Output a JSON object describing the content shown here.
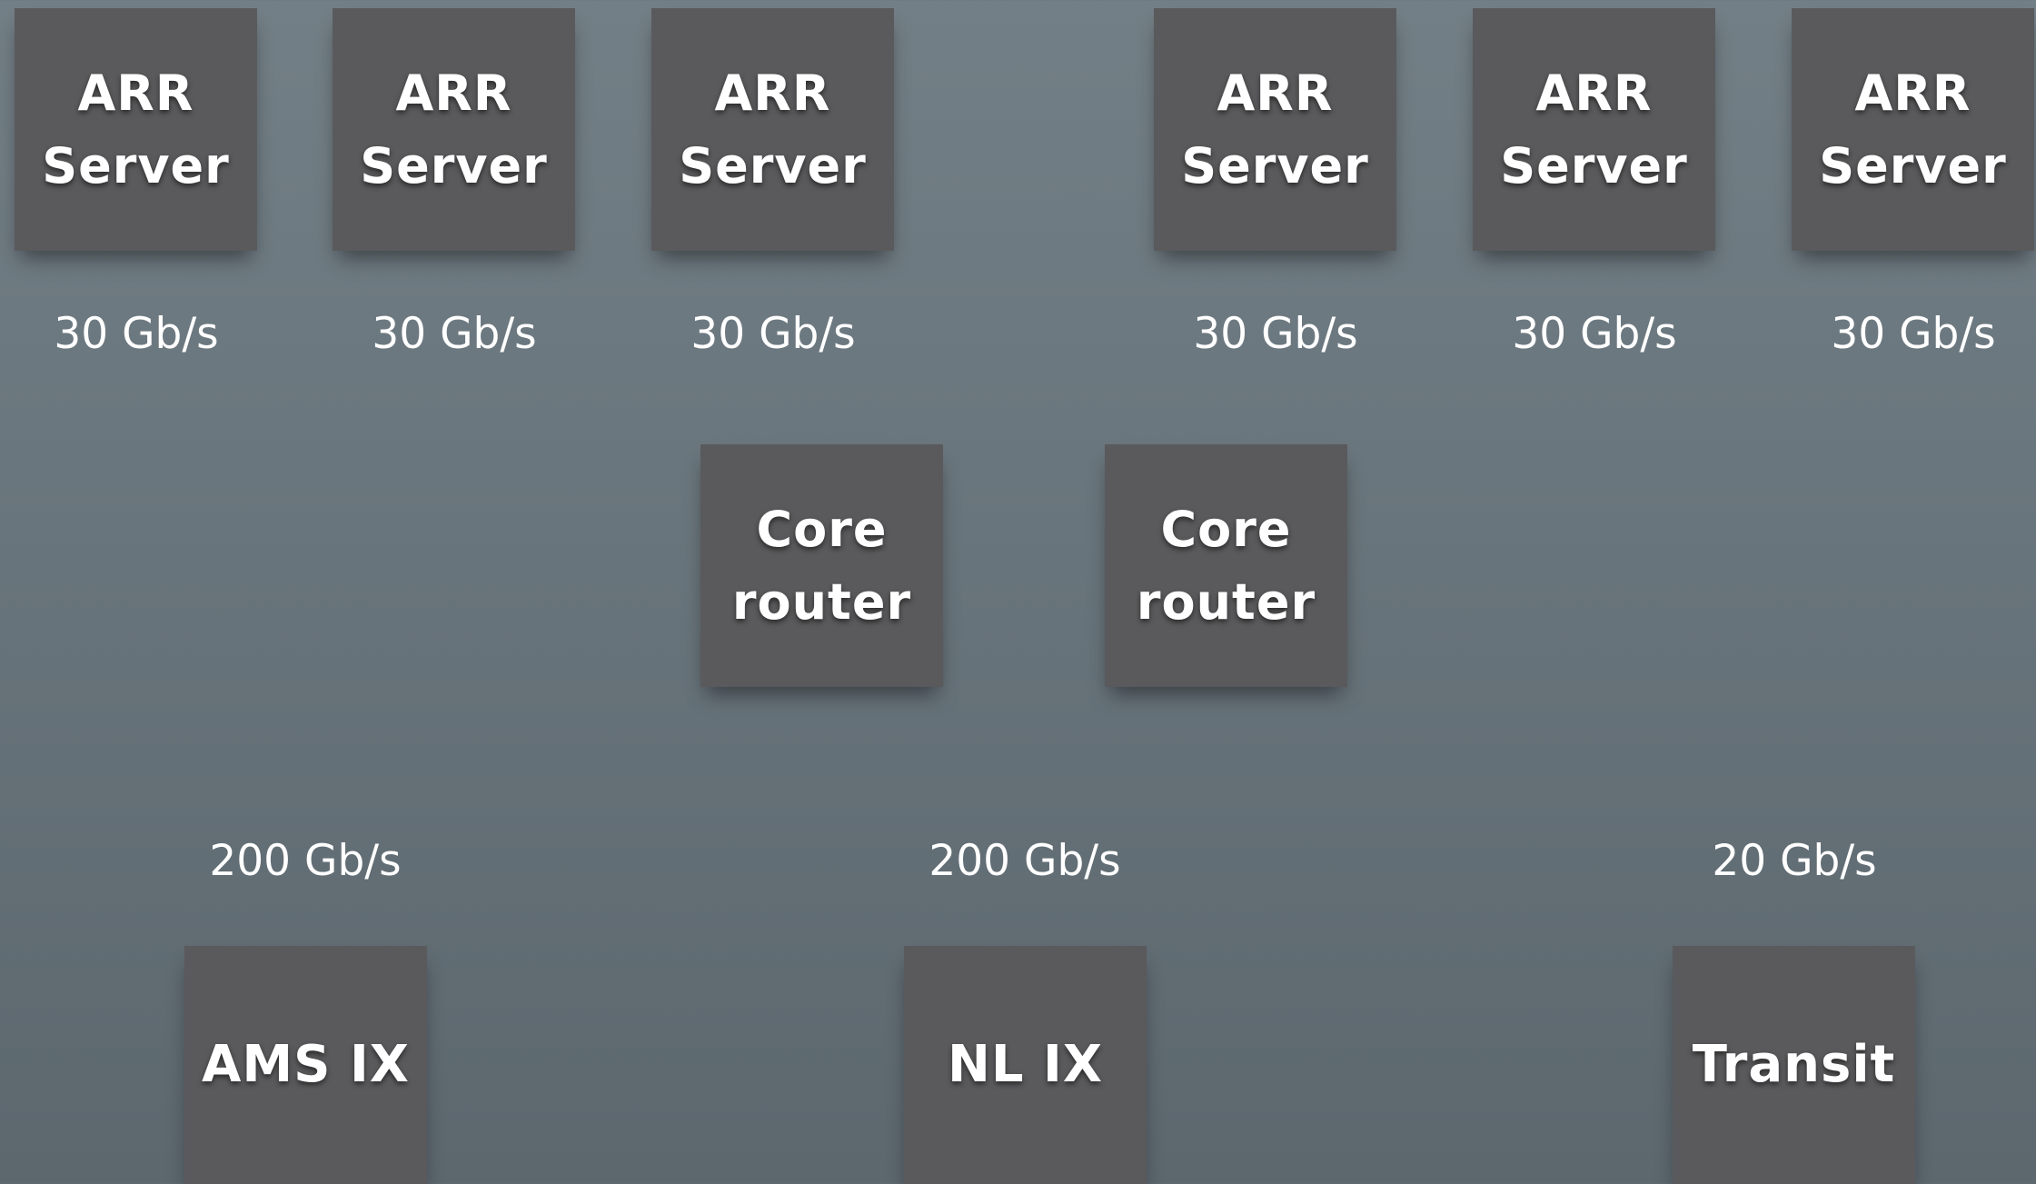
{
  "arr_servers": [
    {
      "label": "ARR\nServer",
      "speed": "30 Gb/s"
    },
    {
      "label": "ARR\nServer",
      "speed": "30 Gb/s"
    },
    {
      "label": "ARR\nServer",
      "speed": "30 Gb/s"
    },
    {
      "label": "ARR\nServer",
      "speed": "30 Gb/s"
    },
    {
      "label": "ARR\nServer",
      "speed": "30 Gb/s"
    },
    {
      "label": "ARR\nServer",
      "speed": "30 Gb/s"
    }
  ],
  "core_routers": [
    {
      "label": "Core\nrouter"
    },
    {
      "label": "Core\nrouter"
    }
  ],
  "uplinks": [
    {
      "label": "AMS IX",
      "speed": "200 Gb/s"
    },
    {
      "label": "NL IX",
      "speed": "200 Gb/s"
    },
    {
      "label": "Transit",
      "speed": "20 Gb/s"
    }
  ],
  "colors": {
    "node_fill": "#5a5a5c",
    "text": "#ffffff",
    "background_top": "#737f86",
    "background_bottom": "#5c676e"
  }
}
